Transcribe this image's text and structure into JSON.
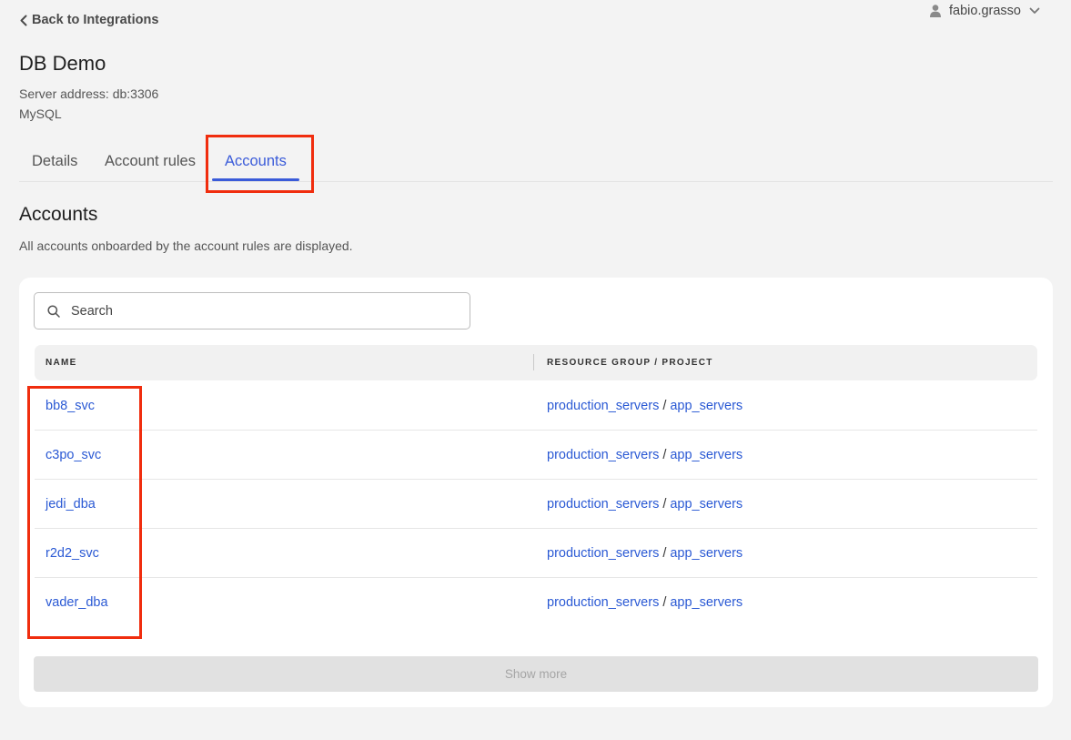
{
  "nav": {
    "back_label": "Back to Integrations"
  },
  "user": {
    "name": "fabio.grasso"
  },
  "integration": {
    "title": "DB Demo",
    "server_address": "Server address: db:3306",
    "db_type": "MySQL"
  },
  "tabs": [
    {
      "label": "Details",
      "active": false
    },
    {
      "label": "Account rules",
      "active": false
    },
    {
      "label": "Accounts",
      "active": true
    }
  ],
  "section": {
    "title": "Accounts",
    "description": "All accounts onboarded by the account rules are displayed."
  },
  "search": {
    "placeholder": "Search",
    "value": ""
  },
  "table": {
    "columns": [
      "NAME",
      "RESOURCE GROUP / PROJECT"
    ],
    "rows": [
      {
        "name": "bb8_svc",
        "resource_group": "production_servers",
        "project": "app_servers"
      },
      {
        "name": "c3po_svc",
        "resource_group": "production_servers",
        "project": "app_servers"
      },
      {
        "name": "jedi_dba",
        "resource_group": "production_servers",
        "project": "app_servers"
      },
      {
        "name": "r2d2_svc",
        "resource_group": "production_servers",
        "project": "app_servers"
      },
      {
        "name": "vader_dba",
        "resource_group": "production_servers",
        "project": "app_servers"
      }
    ],
    "separator": "/"
  },
  "show_more_label": "Show more",
  "colors": {
    "accent": "#3a5bd9",
    "link": "#2a59d4",
    "annotation": "#f02d0e",
    "background": "#f3f3f3"
  },
  "icons": {
    "back": "chevron-left-icon",
    "user": "user-icon",
    "user_menu": "chevron-down-icon",
    "search": "search-icon"
  }
}
